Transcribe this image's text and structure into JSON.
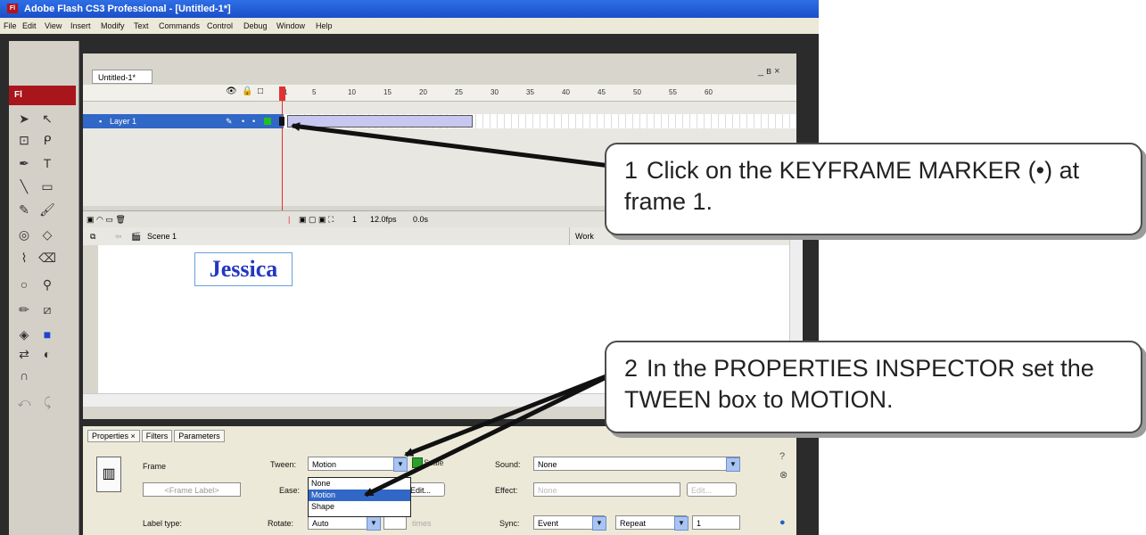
{
  "window": {
    "title": "Adobe Flash CS3 Professional - [Untitled-1*]",
    "app_badge": "Fl",
    "controls": "_ × ×"
  },
  "menu": [
    "File",
    "Edit",
    "View",
    "Insert",
    "Modify",
    "Text",
    "Commands",
    "Control",
    "Debug",
    "Window",
    "Help"
  ],
  "document": {
    "tab": "Untitled-1*",
    "doc_controls": "_ в ×"
  },
  "timeline": {
    "ticks": [
      "1",
      "5",
      "10",
      "15",
      "20",
      "25",
      "30",
      "35",
      "40",
      "45",
      "50",
      "55",
      "60"
    ],
    "layer_name": "Layer 1",
    "status_frame": "1",
    "fps": "12.0fps",
    "time": "0.0s"
  },
  "scene": {
    "name": "Scene 1",
    "workspace": "Work"
  },
  "stage": {
    "text": "Jessica"
  },
  "properties": {
    "tabs": [
      "Properties ×",
      "Filters",
      "Parameters"
    ],
    "frame_label": "Frame",
    "frame_placeholder": "<Frame Label>",
    "label_type": "Label type:",
    "tween_label": "Tween:",
    "tween_value": "Motion",
    "scale_label": "Scale",
    "ease_label": "Ease:",
    "edit_label": "Edit...",
    "rotate_label": "Rotate:",
    "rotate_value": "Auto",
    "times_label": "times",
    "sound_label": "Sound:",
    "sound_value": "None",
    "effect_label": "Effect:",
    "effect_value": "None",
    "effect_edit": "Edit...",
    "sync_label": "Sync:",
    "sync_value": "Event",
    "repeat_value": "Repeat",
    "repeat_count": "1",
    "tween_options": [
      "None",
      "Motion",
      "Shape"
    ]
  },
  "callouts": [
    {
      "number": "1",
      "text": "Click on the KEYFRAME MARKER (•) at frame 1."
    },
    {
      "number": "2",
      "text": "In the PROPERTIES INSPECTOR set the TWEEN box to MOTION."
    }
  ],
  "colors": {
    "title_bar": "#1a4fc8",
    "selected_layer": "#3167c6",
    "playhead": "#e13232",
    "stage_text": "#2337c2",
    "flash_badge": "#a8151b"
  }
}
